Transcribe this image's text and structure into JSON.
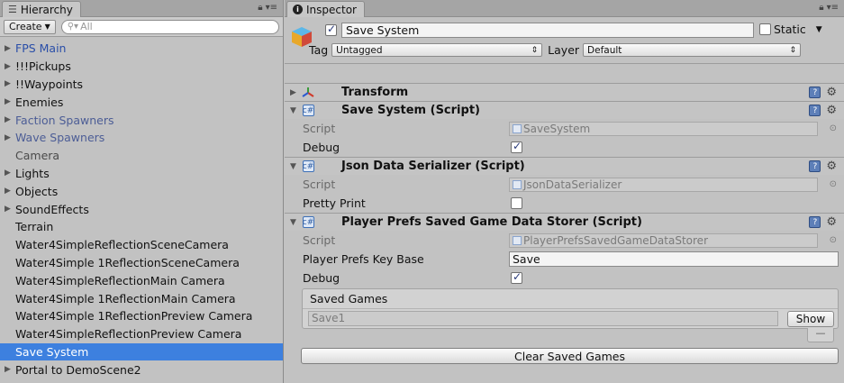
{
  "hierarchy": {
    "tab_label": "Hierarchy",
    "create_label": "Create",
    "search_placeholder": "All",
    "items": [
      {
        "label": "FPS Main",
        "style": "blue",
        "expandable": true,
        "selected": false
      },
      {
        "label": "!!!Pickups",
        "style": "normal",
        "expandable": true,
        "selected": false
      },
      {
        "label": "!!Waypoints",
        "style": "normal",
        "expandable": true,
        "selected": false
      },
      {
        "label": "Enemies",
        "style": "normal",
        "expandable": true,
        "selected": false
      },
      {
        "label": "Faction Spawners",
        "style": "prefab",
        "expandable": true,
        "selected": false
      },
      {
        "label": "Wave Spawners",
        "style": "prefab",
        "expandable": true,
        "selected": false
      },
      {
        "label": "Camera",
        "style": "gray",
        "expandable": false,
        "selected": false
      },
      {
        "label": "Lights",
        "style": "normal",
        "expandable": true,
        "selected": false
      },
      {
        "label": "Objects",
        "style": "normal",
        "expandable": true,
        "selected": false
      },
      {
        "label": "SoundEffects",
        "style": "normal",
        "expandable": true,
        "selected": false
      },
      {
        "label": "Terrain",
        "style": "normal",
        "expandable": false,
        "selected": false
      },
      {
        "label": "Water4SimpleReflectionSceneCamera",
        "style": "normal",
        "expandable": false,
        "selected": false
      },
      {
        "label": "Water4Simple 1ReflectionSceneCamera",
        "style": "normal",
        "expandable": false,
        "selected": false
      },
      {
        "label": "Water4SimpleReflectionMain Camera",
        "style": "normal",
        "expandable": false,
        "selected": false
      },
      {
        "label": "Water4Simple 1ReflectionMain Camera",
        "style": "normal",
        "expandable": false,
        "selected": false
      },
      {
        "label": "Water4Simple 1ReflectionPreview Camera",
        "style": "normal",
        "expandable": false,
        "selected": false
      },
      {
        "label": "Water4SimpleReflectionPreview Camera",
        "style": "normal",
        "expandable": false,
        "selected": false
      },
      {
        "label": "Save System",
        "style": "normal",
        "expandable": false,
        "selected": true
      },
      {
        "label": "Portal to DemoScene2",
        "style": "normal",
        "expandable": true,
        "selected": false
      }
    ]
  },
  "inspector": {
    "tab_label": "Inspector",
    "object_name": "Save System",
    "active": true,
    "static_label": "Static",
    "tag_label": "Tag",
    "tag_value": "Untagged",
    "layer_label": "Layer",
    "layer_value": "Default",
    "transform": {
      "title": "Transform"
    },
    "save_system": {
      "title": "Save System (Script)",
      "script_label": "Script",
      "script_value": "SaveSystem",
      "debug_label": "Debug",
      "debug_checked": true
    },
    "json_serializer": {
      "title": "Json Data Serializer (Script)",
      "script_label": "Script",
      "script_value": "JsonDataSerializer",
      "pretty_print_label": "Pretty Print",
      "pretty_print_checked": false
    },
    "player_prefs": {
      "title": "Player Prefs Saved Game Data Storer (Script)",
      "script_label": "Script",
      "script_value": "PlayerPrefsSavedGameDataStorer",
      "key_base_label": "Player Prefs Key Base",
      "key_base_value": "Save",
      "debug_label": "Debug",
      "debug_checked": true,
      "saved_games_label": "Saved Games",
      "saved_games": [
        "Save1"
      ],
      "show_label": "Show",
      "minus_label": "—",
      "clear_label": "Clear Saved Games"
    }
  }
}
